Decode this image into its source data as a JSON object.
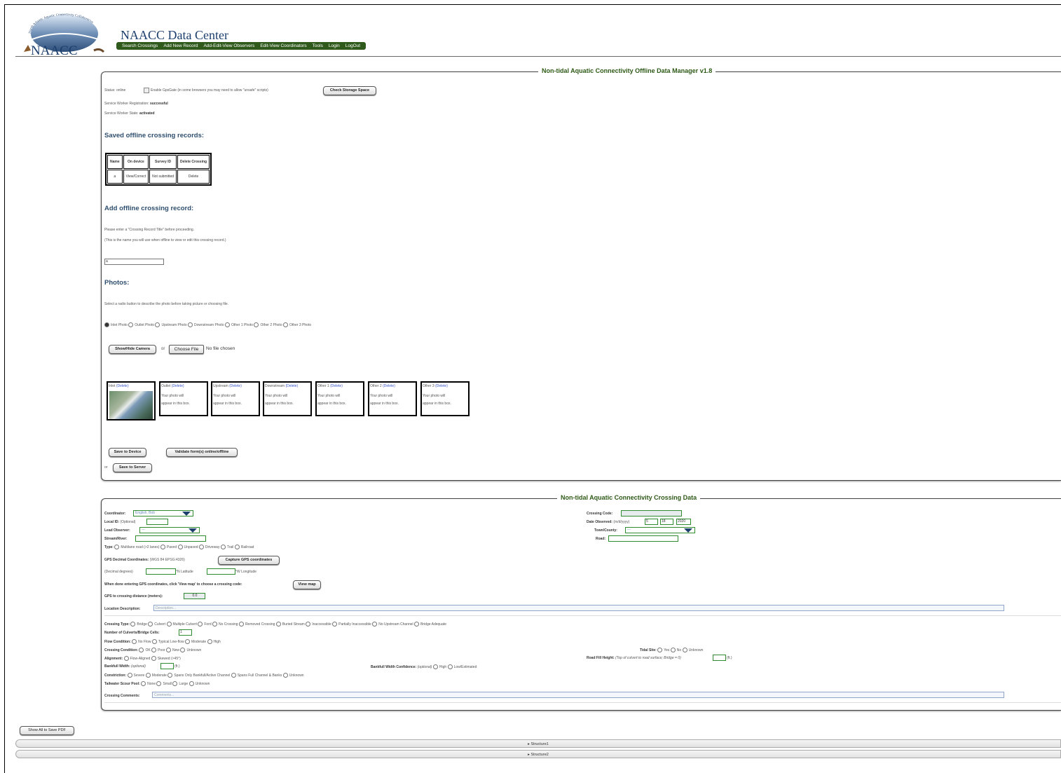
{
  "header": {
    "logo_text": "NAACC",
    "logo_arc_text": "North Atlantic Aquatic Connectivity Collaborative",
    "site_title": "NAACC Data Center",
    "nav": [
      "Search Crossings",
      "Add New Record",
      "Add-Edit-View Observers",
      "Edit-View Coordinators",
      "Tools",
      "Login",
      "LogOut"
    ]
  },
  "offline": {
    "legend": "Non-tidal Aquatic Connectivity Offline Data Manager v1.8",
    "status": "Status: online",
    "gpsgate_label": "Enable GpsGate (in some browsers you may need to allow \"unsafe\" scripts)",
    "check_storage": "Check Storage Space",
    "sw_reg_label": "Service Worker Registration:",
    "sw_reg_value": "successful",
    "sw_state_label": "Service Worker State:",
    "sw_state_value": "activated",
    "saved_heading": "Saved offline crossing records:",
    "table_headers": [
      "Name",
      "On device",
      "Survey ID",
      "Delete Crossing"
    ],
    "table_row": [
      "a",
      "View/Correct",
      "Not submitted",
      "Delete"
    ],
    "add_heading": "Add offline crossing record:",
    "add_note1": "Please enter a \"Crossing Record Title\" before proceeding.",
    "add_note2": "(This is the name you will use when offline to view or edit this crossing record.)",
    "title_value": "a",
    "photos_heading": "Photos:",
    "photos_note": "Select a radio button to describe the photo before taking picture or choosing file.",
    "photo_types": [
      "Inlet Photo",
      "Outlet Photo",
      "Upstream Photo",
      "Downstream Photo",
      "Other 1 Photo",
      "Other 2 Photo",
      "Other 3 Photo"
    ],
    "show_camera": "Show/Hide Camera",
    "or": "or",
    "choose_file": "Choose File",
    "no_file": "No file chosen",
    "boxes": [
      {
        "label": "Inlet",
        "del": "(Delete)"
      },
      {
        "label": "Outlet",
        "del": "(Delete)"
      },
      {
        "label": "Upstream",
        "del": "(Delete)"
      },
      {
        "label": "Downstream",
        "del": "(Delete)"
      },
      {
        "label": "Other 1",
        "del": "(Delete)"
      },
      {
        "label": "Other 2",
        "del": "(Delete)"
      },
      {
        "label": "Other 3",
        "del": "(Delete)"
      }
    ],
    "placeholder_l1": "Your photo will",
    "placeholder_l2": "appear in this box.",
    "save_device": "Save to Device",
    "validate": "Validate form(s) online/offline",
    "or2": "or",
    "save_server": "Save to Server"
  },
  "crossing": {
    "legend": "Non-tidal Aquatic Connectivity Crossing Data",
    "coordinator_label": "Coordinator:",
    "coordinator_value": "English, Bob",
    "local_id_label": "Local ID:",
    "local_id_opt": "(Optional)",
    "lead_observer_label": "Lead Observer:",
    "lead_observer_value": "---",
    "stream_label": "Stream/River:",
    "type_label": "Type:",
    "type_options": [
      "Multilane road (>2 lanes)",
      "Paved",
      "Unpaved",
      "Driveway",
      "Trail",
      "Railroad"
    ],
    "gps_label": "GPS Decimal Coordinates:",
    "gps_note": "(WGS 84 EPSG:4326)",
    "capture_gps": "Capture GPS coordinates",
    "decimal_label": "(Decimal degrees)",
    "lat_label": "°N Latitude",
    "lon_label": "°W Longitude",
    "map_note": "When done entering GPS coordinates, click 'View map' to choose a crossing code:",
    "view_map": "View map",
    "gps_dist_label": "GPS to crossing distance (meters):",
    "gps_dist_value": "0.0",
    "location_label": "Location Description:",
    "location_placeholder": "Description...",
    "crossing_code_label": "Crossing Code:",
    "date_label": "Date Observed:",
    "date_format": "(m/d/yyyy)",
    "date_m": "5",
    "date_d": "18",
    "date_y": "2020",
    "town_label": "Town/County:",
    "town_value": "---",
    "road_label": "Road:",
    "crossing_type_label": "Crossing Type:",
    "crossing_types": [
      "Bridge",
      "Culvert",
      "Multiple Culvert",
      "Ford",
      "No Crossing",
      "Removed Crossing",
      "Buried Stream",
      "Inaccessible",
      "Partially Inaccessible",
      "No Upstream Channel",
      "Bridge Adequate"
    ],
    "num_cells_label": "Number of Culverts/Bridge Cells:",
    "num_cells_value": "1",
    "flow_label": "Flow Condition:",
    "flow_options": [
      "No Flow",
      "Typical Low-flow",
      "Moderate",
      "High"
    ],
    "cond_label": "Crossing Condition:",
    "cond_options": [
      "OK",
      "Poor",
      "New",
      "Unknown"
    ],
    "tidal_label": "Tidal Site:",
    "tidal_options": [
      "Yes",
      "No",
      "Unknown"
    ],
    "align_label": "Alignment:",
    "align_options": [
      "Flow-Aligned",
      "Skewed (>45°)"
    ],
    "fill_label": "Road Fill Height:",
    "fill_note": "(Top of culvert to road surface; Bridge = 0)",
    "fill_unit": "(ft.)",
    "bankfull_label": "Bankfull Width:",
    "bankfull_opt": "(optional)",
    "bankfull_unit": "(ft.)",
    "bw_conf_label": "Bankfull Width Confidence:",
    "bw_conf_opt": "(optional)",
    "bw_conf_options": [
      "High",
      "Low/Estimated"
    ],
    "constr_label": "Constriction:",
    "constr_options": [
      "Severe",
      "Moderate",
      "Spans Only Bankfull/Active Channel",
      "Spans Full Channel & Banks",
      "Unknown"
    ],
    "tailwater_label": "Tailwater Scour Pool:",
    "tailwater_options": [
      "None",
      "Small",
      "Large",
      "Unknown"
    ],
    "comments_label": "Crossing Comments:",
    "comments_placeholder": "Comments..."
  },
  "footer": {
    "show_all": "Show All to Save PDF",
    "structure1": "▸ Structure1",
    "structure2": "▸ Structure2"
  }
}
